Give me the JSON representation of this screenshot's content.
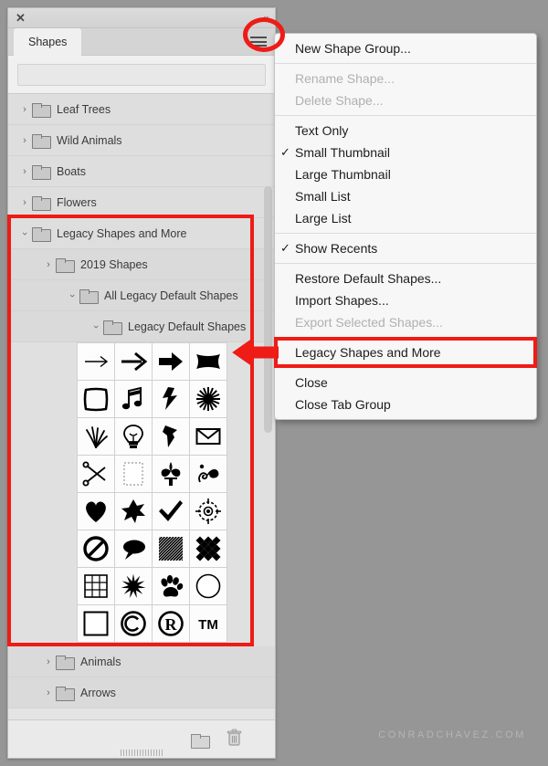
{
  "app": {
    "background_color": "#969696",
    "watermark": "CONRADCHAVEZ.COM"
  },
  "panel": {
    "close_label": "✕",
    "collapse_label": "«",
    "menu_icon_name": "hamburger-menu-icon",
    "tabs": [
      {
        "label": "Shapes",
        "active": true
      }
    ],
    "search": {
      "value": "",
      "placeholder": ""
    },
    "tree": [
      {
        "label": "Leaf Trees",
        "level": 0,
        "expanded": false
      },
      {
        "label": "Wild Animals",
        "level": 0,
        "expanded": false
      },
      {
        "label": "Boats",
        "level": 0,
        "expanded": false
      },
      {
        "label": "Flowers",
        "level": 0,
        "expanded": false
      },
      {
        "label": "Legacy Shapes and More",
        "level": 0,
        "expanded": true
      },
      {
        "label": "2019 Shapes",
        "level": 1,
        "expanded": false
      },
      {
        "label": "All Legacy Default Shapes",
        "level": 2,
        "expanded": true
      },
      {
        "label": "Legacy Default Shapes",
        "level": 3,
        "expanded": true
      }
    ],
    "tree_tail": [
      {
        "label": "Animals",
        "level": 1,
        "expanded": false
      },
      {
        "label": "Arrows",
        "level": 1,
        "expanded": false
      }
    ],
    "twirl_closed": "›",
    "twirl_open": "⌄",
    "shape_grid": {
      "columns": 4,
      "shapes": [
        "thin-arrow-right-shape",
        "medium-arrow-right-shape",
        "bold-arrow-right-shape",
        "pillow-banner-shape",
        "sketch-square-shape",
        "music-eighth-notes-shape",
        "lightning-bolt-shape",
        "starburst-12-point-shape",
        "grass-tuft-shape",
        "light-bulb-shape",
        "push-pin-shape",
        "envelope-shape",
        "scissors-shape",
        "dashed-frame-shape",
        "fleur-de-lis-shape",
        "ornament-flourish-shape",
        "heart-shape",
        "splat-blob-shape",
        "check-mark-shape",
        "crosshair-target-shape",
        "no-entry-sign-shape",
        "speech-bubble-shape",
        "diagonal-hatch-square-shape",
        "diamond-checker-shape",
        "grid-tile-shape",
        "jagged-star-shape",
        "paw-print-shape",
        "circle-outline-shape",
        "square-outline-shape",
        "copyright-symbol-shape",
        "registered-symbol-shape",
        "trademark-symbol-shape"
      ]
    },
    "footer": {
      "new_folder_label": "new-folder-icon",
      "delete_label": "trash-icon"
    }
  },
  "flyout_menu": {
    "items": [
      {
        "label": "New Shape Group...",
        "checked": false,
        "disabled": false,
        "separator_after": true
      },
      {
        "label": "Rename Shape...",
        "checked": false,
        "disabled": true,
        "separator_after": false
      },
      {
        "label": "Delete Shape...",
        "checked": false,
        "disabled": true,
        "separator_after": true
      },
      {
        "label": "Text Only",
        "checked": false,
        "disabled": false,
        "separator_after": false
      },
      {
        "label": "Small Thumbnail",
        "checked": true,
        "disabled": false,
        "separator_after": false
      },
      {
        "label": "Large Thumbnail",
        "checked": false,
        "disabled": false,
        "separator_after": false
      },
      {
        "label": "Small List",
        "checked": false,
        "disabled": false,
        "separator_after": false
      },
      {
        "label": "Large List",
        "checked": false,
        "disabled": false,
        "separator_after": true
      },
      {
        "label": "Show Recents",
        "checked": true,
        "disabled": false,
        "separator_after": true
      },
      {
        "label": "Restore Default Shapes...",
        "checked": false,
        "disabled": false,
        "separator_after": false
      },
      {
        "label": "Import Shapes...",
        "checked": false,
        "disabled": false,
        "separator_after": false
      },
      {
        "label": "Export Selected Shapes...",
        "checked": false,
        "disabled": true,
        "separator_after": true
      },
      {
        "label": "Legacy Shapes and More",
        "checked": false,
        "disabled": false,
        "separator_after": true,
        "highlighted": true
      },
      {
        "label": "Close",
        "checked": false,
        "disabled": false,
        "separator_after": false
      },
      {
        "label": "Close Tab Group",
        "checked": false,
        "disabled": false,
        "separator_after": false
      }
    ],
    "check_glyph": "✓"
  },
  "annotations": {
    "accent_color": "#ee1b16",
    "circle_target": "hamburger-menu-icon",
    "box_tree_target": "legacy-shapes-and-more-tree-branch",
    "box_menu_target": "Legacy Shapes and More",
    "arrow_direction": "left"
  }
}
